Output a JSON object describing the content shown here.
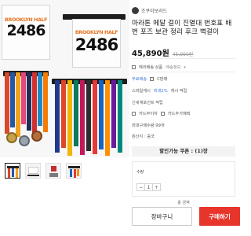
{
  "product_image": {
    "bib_left": {
      "name": "BROOKLYN HALF",
      "number": "2486"
    },
    "bib_right": {
      "name": "BROOKLYN HALF",
      "number": "2486"
    }
  },
  "thumbnails": [
    {
      "label": "thumbnail-1",
      "active": true
    },
    {
      "label": "thumbnail-2",
      "active": false
    },
    {
      "label": "thumbnail-3",
      "active": false
    },
    {
      "label": "thumbnail-4",
      "active": false
    }
  ],
  "brand": {
    "name": "조쿠이보라드"
  },
  "product": {
    "title": "마라톤 메달 걸이 진열대 번호표 배번 포즈 보관 정리 후크 벽걸이",
    "price": "45,890원",
    "original_price": "45,990원"
  },
  "info_rows": {
    "shipping_label": "해외배송 상품",
    "shipping_info": "배송정보",
    "free_shipping": "무료배송",
    "free_shipping_badge": "C판매",
    "points_prefix": "스마일캐시",
    "points_value": "최대2%",
    "points_suffix": "캐시 적립",
    "card_benefit": "신세계포인트 적립",
    "card_discount": "카드무이자",
    "card_installment": "카드추가혜택",
    "purchase_limit": "최대구매수량 99개",
    "origin": "원산지 : 중국"
  },
  "coupon": {
    "label": "할인가능 쿠폰 : (1)장"
  },
  "options": {
    "label": "수량",
    "quantity": "1",
    "minus": "−",
    "plus": "+"
  },
  "total": {
    "label": "총 금액"
  },
  "actions": {
    "cart": "장바구니",
    "buy": "구매하기"
  },
  "colors": {
    "buy_button": "#e8352b",
    "price": "#111111",
    "accent_blue": "#3b7ad9"
  }
}
